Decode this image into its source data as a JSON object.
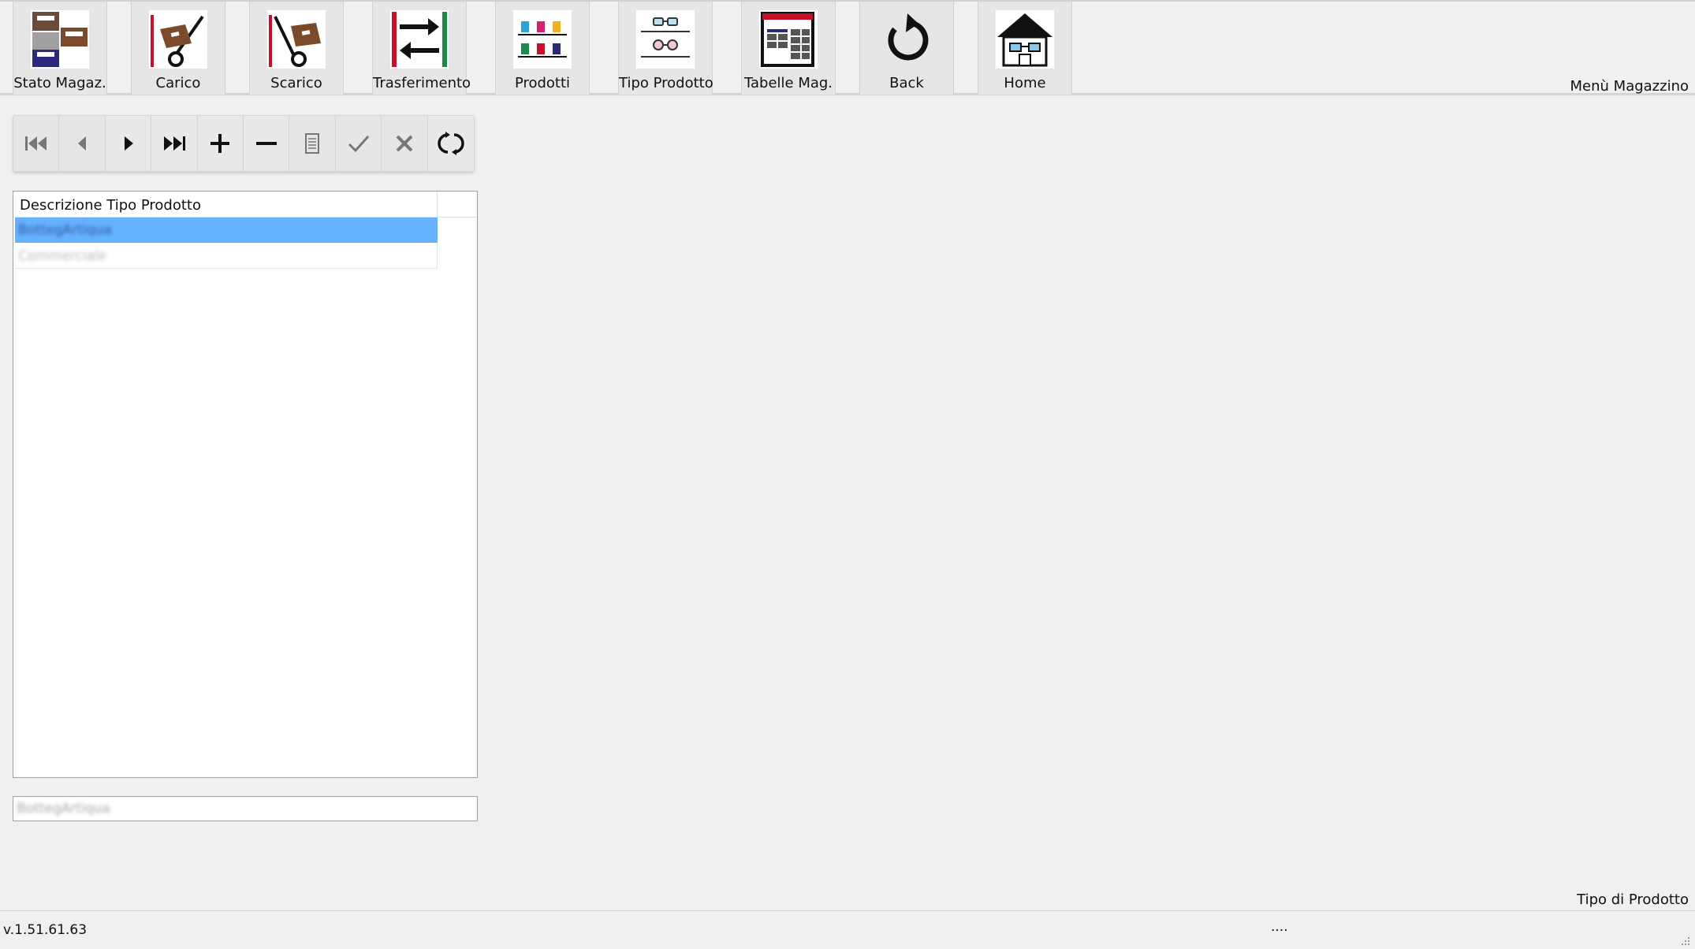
{
  "toolbar": {
    "buttons": [
      {
        "label": "Stato Magaz.",
        "icon": "warehouse-stock-icon"
      },
      {
        "label": "Carico",
        "icon": "hand-truck-load-icon"
      },
      {
        "label": "Scarico",
        "icon": "hand-truck-unload-icon"
      },
      {
        "label": "Trasferimento",
        "icon": "transfer-icon"
      },
      {
        "label": "Prodotti",
        "icon": "products-shelf-icon"
      },
      {
        "label": "Tipo Prodotto",
        "icon": "glasses-shelf-icon"
      },
      {
        "label": "Tabelle Mag.",
        "icon": "tables-icon"
      },
      {
        "label": "Back",
        "icon": "undo-arrow-icon"
      },
      {
        "label": "Home",
        "icon": "home-icon"
      }
    ],
    "menu_title": "Menù Magazzino"
  },
  "navigator": {
    "buttons": [
      "first-record-icon",
      "previous-record-icon",
      "next-record-icon",
      "last-record-icon",
      "add-record-icon",
      "delete-record-icon",
      "edit-record-icon",
      "confirm-icon",
      "cancel-icon",
      "refresh-icon"
    ]
  },
  "grid": {
    "header": "Descrizione Tipo Prodotto",
    "rows": [
      "BottegArtiqua",
      "Commerciale"
    ]
  },
  "detail": {
    "value": "BottegArtiqua"
  },
  "form_title": "Tipo di Prodotto",
  "status": {
    "version": "v.1.51.61.63",
    "dots": "...."
  },
  "colors": {
    "selection": "#66b2ff",
    "background": "#f0f0f0",
    "button": "#e6e6e6"
  }
}
